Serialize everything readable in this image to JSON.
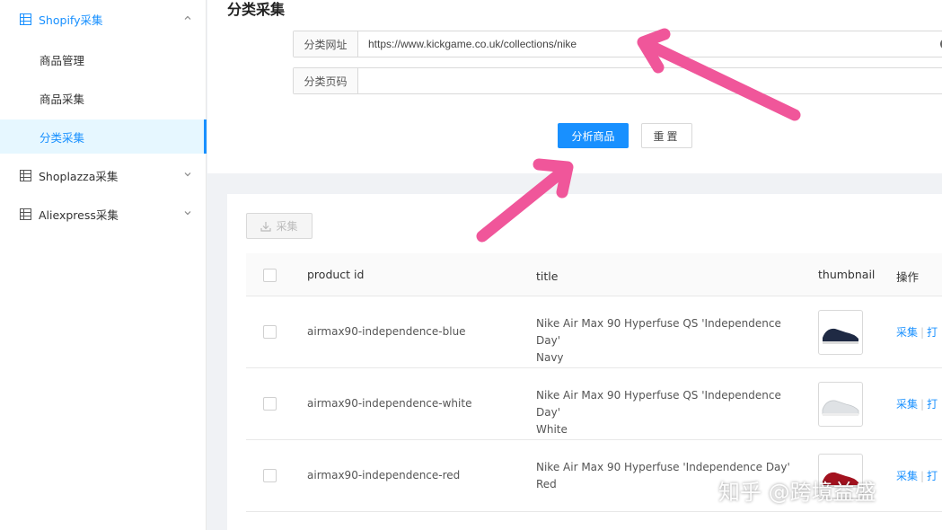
{
  "sidebar": {
    "groups": [
      {
        "label": "Shopify采集",
        "expanded": true
      },
      {
        "label": "Shoplazza采集",
        "expanded": false
      },
      {
        "label": "Aliexpress采集",
        "expanded": false
      }
    ],
    "sub_items": [
      {
        "label": "商品管理"
      },
      {
        "label": "商品采集"
      },
      {
        "label": "分类采集",
        "selected": true
      }
    ]
  },
  "form": {
    "title": "分类采集",
    "url_label": "分类网址",
    "url_value": "https://www.kickgame.co.uk/collections/nike",
    "page_label": "分类页码",
    "page_value": "",
    "analyze_button": "分析商品",
    "reset_button": "重置"
  },
  "content": {
    "collect_button": "采集",
    "columns": {
      "product_id": "product id",
      "title": "title",
      "thumbnail": "thumbnail",
      "actions": "操作"
    },
    "rows": [
      {
        "id": "airmax90-independence-blue",
        "title_line1": "Nike Air Max 90 Hyperfuse QS 'Independence Day'",
        "title_line2": "Navy",
        "thumb_color": "#1f2a44",
        "op1": "采集",
        "op2": "打"
      },
      {
        "id": "airmax90-independence-white",
        "title_line1": "Nike Air Max 90 Hyperfuse QS 'Independence Day'",
        "title_line2": "White",
        "thumb_color": "#e9ecef",
        "op1": "采集",
        "op2": "打"
      },
      {
        "id": "airmax90-independence-red",
        "title_line1": "Nike Air Max 90 Hyperfuse 'Independence Day'",
        "title_line2": "Red",
        "thumb_color": "#a3121f",
        "op1": "采集",
        "op2": "打"
      }
    ]
  },
  "watermark": "知乎 @跨境益盛",
  "colors": {
    "primary": "#1890ff",
    "annotation_arrow": "#f0569a"
  }
}
